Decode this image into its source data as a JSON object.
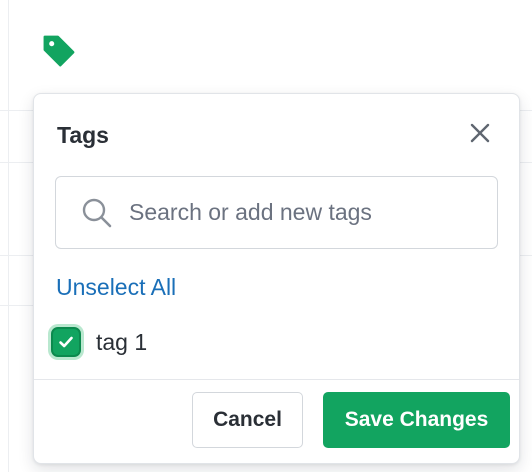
{
  "colors": {
    "accent": "#12a460",
    "link": "#1a6fb8",
    "text": "#2a2f36",
    "border": "#d3d7dc"
  },
  "background": {
    "tag_icon": "tag-icon"
  },
  "popover": {
    "title": "Tags",
    "close_icon": "close-icon",
    "search": {
      "icon": "search-icon",
      "placeholder": "Search or add new tags",
      "value": ""
    },
    "unselect_all_label": "Unselect All",
    "tags": [
      {
        "label": "tag 1",
        "checked": true
      }
    ],
    "footer": {
      "cancel_label": "Cancel",
      "save_label": "Save Changes"
    }
  }
}
